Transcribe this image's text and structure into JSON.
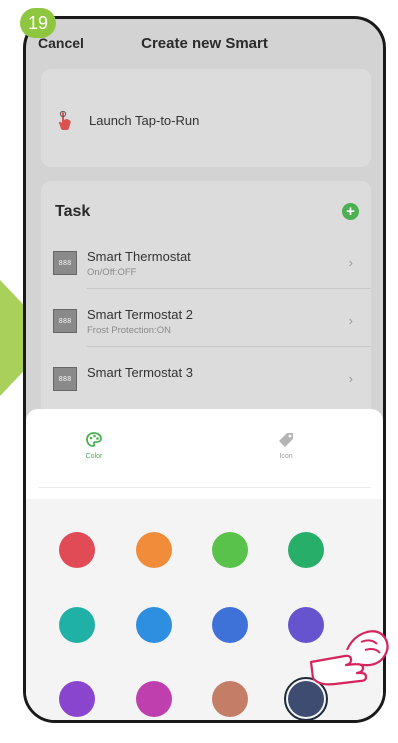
{
  "step_number": "19",
  "header": {
    "cancel_label": "Cancel",
    "title": "Create new Smart"
  },
  "launch": {
    "label": "Launch Tap-to-Run"
  },
  "task": {
    "title": "Task",
    "items": [
      {
        "name": "Smart Thermostat",
        "subtitle": "On/Off:OFF"
      },
      {
        "name": "Smart Termostat 2",
        "subtitle": "Frost Protection:ON"
      },
      {
        "name": "Smart Termostat 3",
        "subtitle": ""
      }
    ]
  },
  "sheet": {
    "tabs": [
      {
        "label": "Color",
        "icon": "palette-icon",
        "active": true
      },
      {
        "label": "Icon",
        "icon": "tag-icon",
        "active": false
      }
    ],
    "colors": [
      "#e04b55",
      "#f18c3a",
      "#58c24a",
      "#27ae68",
      "#1fb0a6",
      "#2e8fe0",
      "#3f72d8",
      "#6654cf",
      "#8a45cf",
      "#c03fae",
      "#c47d66",
      "#3d4c70"
    ],
    "selected_color_index": 11
  }
}
